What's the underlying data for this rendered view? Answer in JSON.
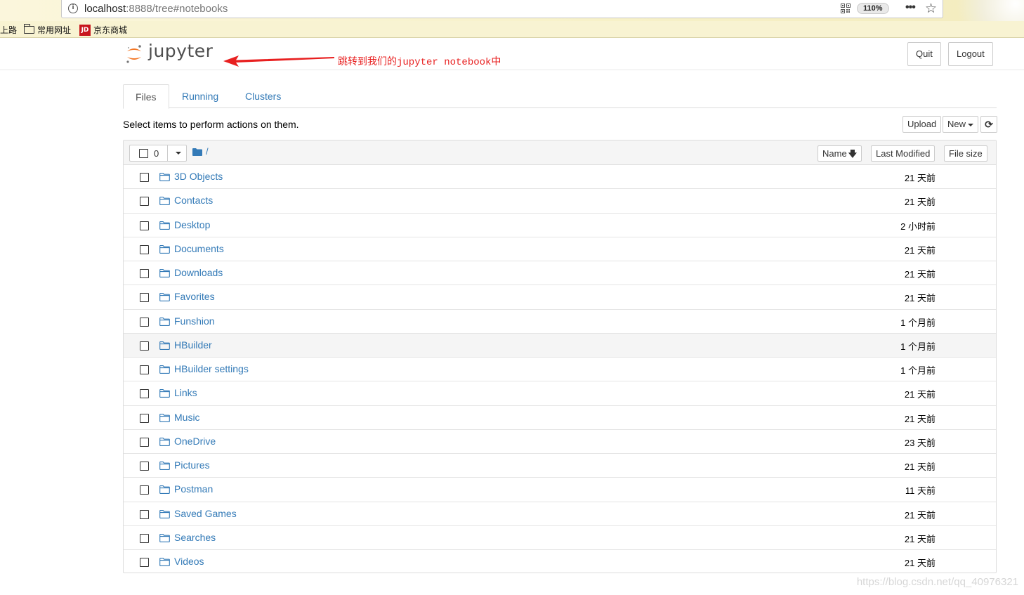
{
  "browser": {
    "url_host": "localhost",
    "url_rest": ":8888/tree#notebooks",
    "zoom": "110%",
    "bookmarks": [
      "上路",
      "常用网址",
      "京东商城"
    ]
  },
  "header": {
    "logo_text": "jupyter",
    "annotation": "跳转到我们的jupyter notebook中",
    "quit_label": "Quit",
    "logout_label": "Logout"
  },
  "tabs": [
    "Files",
    "Running",
    "Clusters"
  ],
  "toolbar": {
    "message": "Select items to perform actions on them.",
    "upload_label": "Upload",
    "new_label": "New"
  },
  "list_header": {
    "selected_count": "0",
    "path": "/",
    "sort_name": "Name",
    "sort_modified": "Last Modified",
    "sort_size": "File size"
  },
  "files": [
    {
      "name": "3D Objects",
      "modified": "21 天前"
    },
    {
      "name": "Contacts",
      "modified": "21 天前"
    },
    {
      "name": "Desktop",
      "modified": "2 小时前"
    },
    {
      "name": "Documents",
      "modified": "21 天前"
    },
    {
      "name": "Downloads",
      "modified": "21 天前"
    },
    {
      "name": "Favorites",
      "modified": "21 天前"
    },
    {
      "name": "Funshion",
      "modified": "1 个月前"
    },
    {
      "name": "HBuilder",
      "modified": "1 个月前"
    },
    {
      "name": "HBuilder settings",
      "modified": "1 个月前"
    },
    {
      "name": "Links",
      "modified": "21 天前"
    },
    {
      "name": "Music",
      "modified": "21 天前"
    },
    {
      "name": "OneDrive",
      "modified": "23 天前"
    },
    {
      "name": "Pictures",
      "modified": "21 天前"
    },
    {
      "name": "Postman",
      "modified": "11 天前"
    },
    {
      "name": "Saved Games",
      "modified": "21 天前"
    },
    {
      "name": "Searches",
      "modified": "21 天前"
    },
    {
      "name": "Videos",
      "modified": "21 天前"
    }
  ],
  "watermark": "https://blog.csdn.net/qq_40976321",
  "colors": {
    "link": "#337ab7",
    "logo_orange": "#f37726",
    "annotation_red": "#e82020"
  }
}
